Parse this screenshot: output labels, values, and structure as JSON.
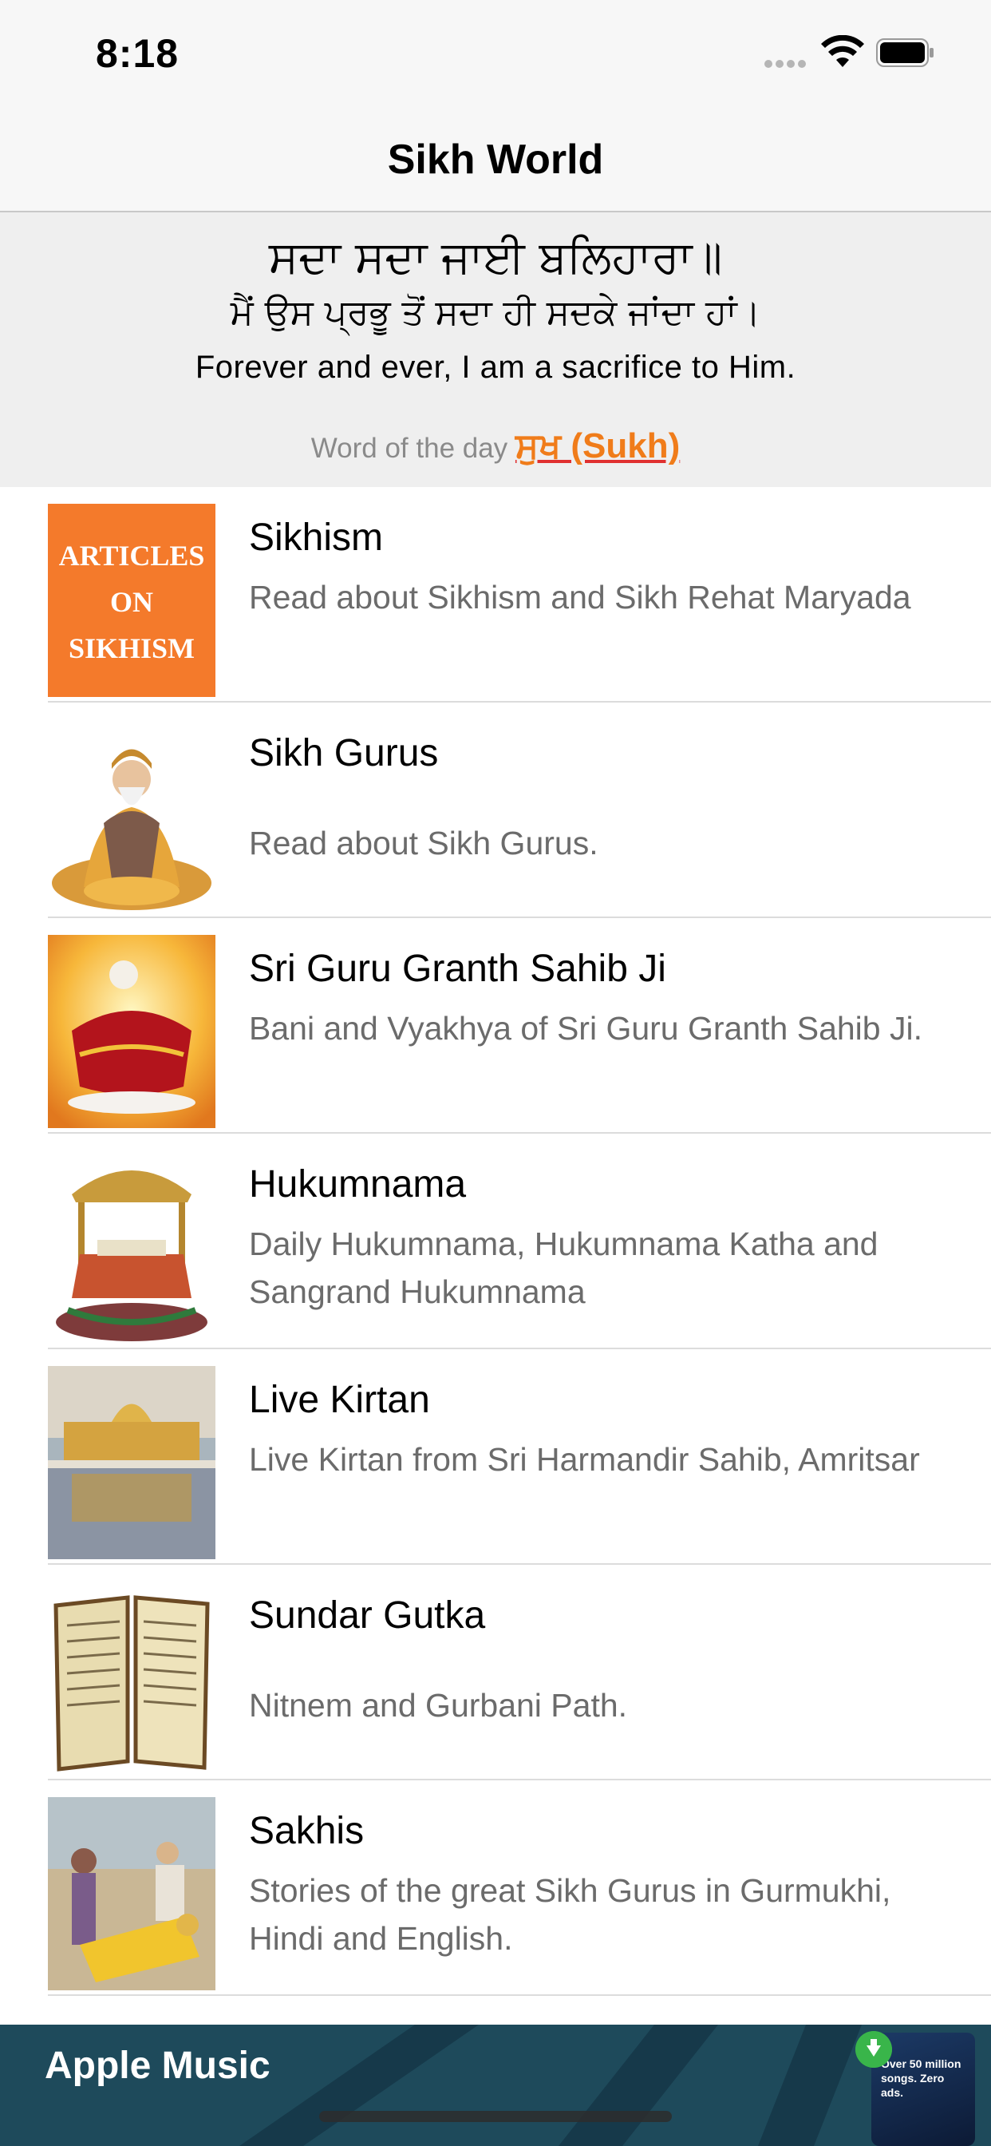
{
  "status_bar": {
    "time": "8:18"
  },
  "nav": {
    "title": "Sikh World"
  },
  "quote": {
    "gurmukhi_line": "ਸਦਾ ਸਦਾ ਜਾਈ ਬਲਿਹਾਰਾ॥",
    "punjabi_meaning": "ਮੈਂ ਉਸ ਪ੍ਰਭੂ ਤੋਂ ਸਦਾ ਹੀ ਸਦਕੇ ਜਾਂਦਾ ਹਾਂ।",
    "english_meaning": "Forever and ever, I am a sacrifice to Him.",
    "word_of_day_label": "Word of the day",
    "word_of_day_value": "ਸੁਖ (Sukh)"
  },
  "articles_thumb": {
    "lines": [
      "ARTICLES",
      "ON",
      "SIKHISM"
    ]
  },
  "menu": [
    {
      "title": "Sikhism",
      "subtitle": "Read about Sikhism and Sikh Rehat Maryada",
      "icon": "articles-on-sikhism-image"
    },
    {
      "title": "Sikh Gurus",
      "subtitle": "Read about Sikh Gurus.",
      "icon": "guru-image"
    },
    {
      "title": "Sri Guru Granth Sahib Ji",
      "subtitle": "Bani and Vyakhya of Sri Guru Granth Sahib Ji.",
      "icon": "granth-sahib-image"
    },
    {
      "title": "Hukumnama",
      "subtitle": "Daily Hukumnama, Hukumnama Katha and Sangrand Hukumnama",
      "icon": "palki-image"
    },
    {
      "title": "Live Kirtan",
      "subtitle": "Live Kirtan from Sri Harmandir Sahib, Amritsar",
      "icon": "golden-temple-image"
    },
    {
      "title": "Sundar Gutka",
      "subtitle": "Nitnem and Gurbani Path.",
      "icon": "gutka-book-image"
    },
    {
      "title": "Sakhis",
      "subtitle": "Stories of the great Sikh Gurus in Gurmukhi, Hindi and English.",
      "icon": "sakhi-painting-image"
    }
  ],
  "ad": {
    "title": "Apple Music",
    "thumb_text": "Over 50 million songs. Zero ads."
  },
  "colors": {
    "accent": "#f07c1a",
    "ad_bg": "#1e4a5b",
    "articles_bg": "#f47a2b"
  }
}
